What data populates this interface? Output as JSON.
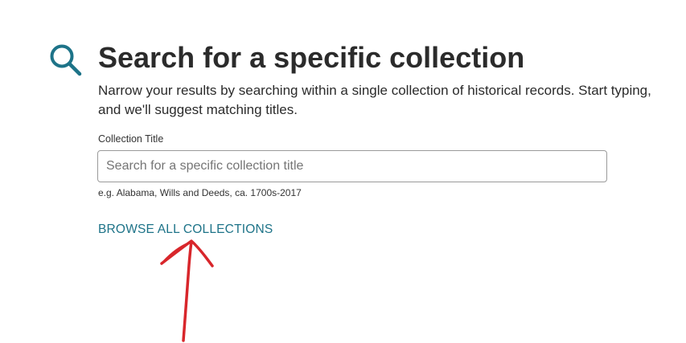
{
  "header": {
    "icon": "search-icon",
    "title": "Search for a specific collection",
    "description": "Narrow your results by searching within a single collection of historical records. Start typing, and we'll suggest matching titles."
  },
  "form": {
    "label": "Collection Title",
    "placeholder": "Search for a specific collection title",
    "value": "",
    "hint": "e.g. Alabama, Wills and Deeds, ca. 1700s-2017"
  },
  "links": {
    "browse_all": "BROWSE ALL COLLECTIONS"
  },
  "colors": {
    "accent": "#1d7388",
    "annotation": "#d8262b",
    "text": "#2b2b2b"
  }
}
